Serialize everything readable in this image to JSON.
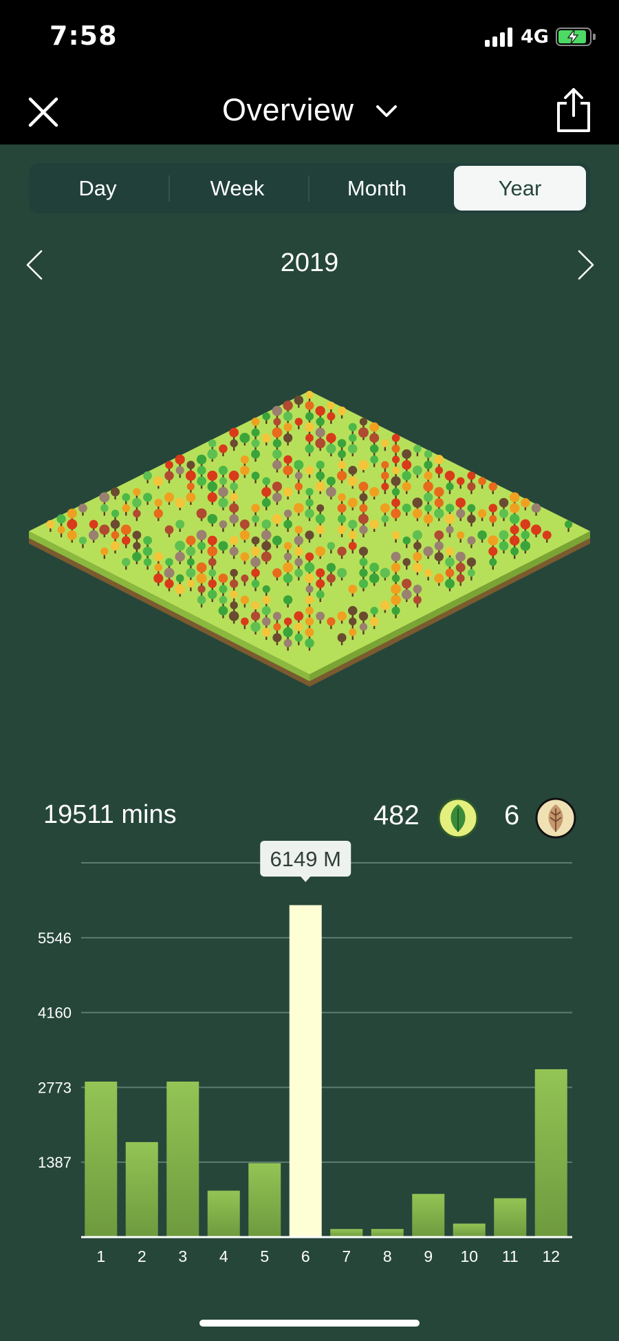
{
  "status_bar": {
    "time": "7:58",
    "network": "4G",
    "battery_charging": true,
    "colors": {
      "battery_fill": "#4cd964"
    }
  },
  "nav": {
    "title": "Overview",
    "close_icon": "close-icon",
    "dropdown_icon": "chevron-down-icon",
    "share_icon": "share-icon"
  },
  "tabs": [
    {
      "label": "Day",
      "active": false
    },
    {
      "label": "Week",
      "active": false
    },
    {
      "label": "Month",
      "active": false
    },
    {
      "label": "Year",
      "active": true
    }
  ],
  "period": {
    "label": "2019",
    "prev_icon": "chevron-left-icon",
    "next_icon": "chevron-right-icon"
  },
  "forest": {
    "image": "isometric-forest-grid",
    "colors": {
      "grass_top": "#b7e05a",
      "grass_side": "#8bb83e",
      "soil": "#7a5a2e"
    }
  },
  "stats": {
    "total": "19511 mins",
    "healthy_trees": "482",
    "healthy_icon": "leaf-icon",
    "dead_trees": "6",
    "dead_icon": "withered-leaf-icon"
  },
  "chart_data": {
    "type": "bar",
    "categories": [
      "1",
      "2",
      "3",
      "4",
      "5",
      "6",
      "7",
      "8",
      "9",
      "10",
      "11",
      "12"
    ],
    "values": [
      2880,
      1760,
      2880,
      860,
      1370,
      6149,
      150,
      150,
      800,
      250,
      720,
      3110
    ],
    "y_ticks": [
      "1387",
      "2773",
      "4160",
      "5546"
    ],
    "ylim": [
      0,
      6933
    ],
    "highlight_index": 5,
    "tooltip": "6149 M",
    "grid": true,
    "colors": {
      "bar": "#8ab64e",
      "bar_highlight": "#ffffd5",
      "grid": "#5e7d70",
      "axis": "#ffffff"
    }
  }
}
